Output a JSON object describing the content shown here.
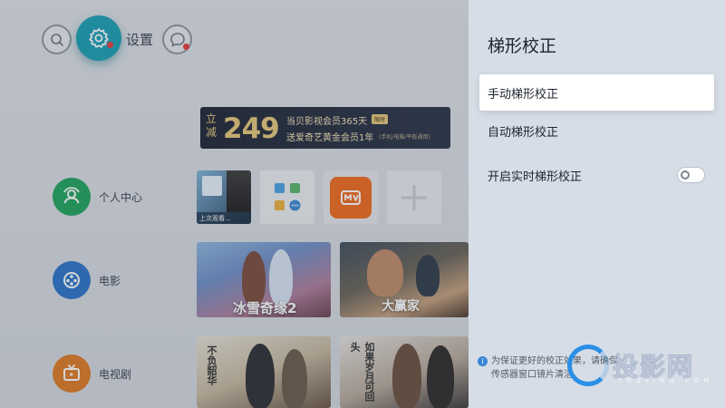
{
  "header": {
    "settings_label": "设置"
  },
  "banner": {
    "prefix": "立减",
    "amount": "249",
    "line1": "当贝影视会员365天",
    "tag": "限时",
    "line2": "送爱奇艺黄金会员1年",
    "line2_note": "(手机/电脑/平板通用)"
  },
  "nav": {
    "items": [
      {
        "label": "个人中心",
        "icon": "person-icon",
        "color": "#1fa55b"
      },
      {
        "label": "电影",
        "icon": "film-reel-icon",
        "color": "#2b74c9"
      },
      {
        "label": "电视剧",
        "icon": "tv-icon",
        "color": "#e07a22"
      }
    ]
  },
  "tiles": {
    "recent_caption": "上次观看...",
    "mango_app": "mango-tv-icon",
    "add_app": "plus-icon"
  },
  "posters": {
    "frozen_title": "冰雪奇缘2",
    "winner_title": "大赢家",
    "drama1_title": "不负韶华",
    "drama2_title": "如果岁月可回头"
  },
  "panel": {
    "title": "梯形校正",
    "options": [
      "手动梯形校正",
      "自动梯形校正",
      "开启实时梯形校正"
    ],
    "realtime_toggle_on": false,
    "hint": "为保证更好的校正效果，请确保传感器窗口镜片清洁。"
  },
  "watermark": {
    "brand": "投影网",
    "domain": "TOUYING.COM"
  },
  "colors": {
    "accent": "#1a9fb4",
    "panel_bg": "#d6dde6",
    "info": "#3a86d6"
  }
}
